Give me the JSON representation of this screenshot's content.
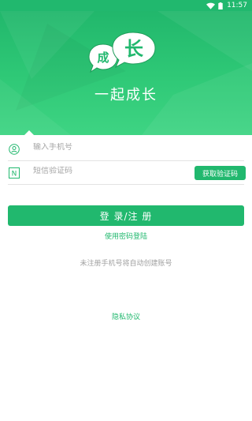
{
  "status_bar": {
    "time": "11:57"
  },
  "header": {
    "logo_char_small": "成",
    "logo_char_large": "长",
    "slogan": "一起成长"
  },
  "form": {
    "phone_placeholder": "输入手机号",
    "code_placeholder": "短信验证码",
    "get_code_label": "获取验证码",
    "code_icon_letter": "N"
  },
  "actions": {
    "login_label": "登 录/注 册",
    "password_login_link": "使用密码登陆",
    "auto_register_hint": "未注册手机号将自动创建账号",
    "privacy_link": "隐私协议"
  },
  "colors": {
    "primary": "#21b86e",
    "header_light": "#3ed483"
  },
  "icons": {
    "status_wifi": "wifi-icon",
    "status_battery": "battery-icon",
    "phone_field": "user-icon",
    "code_field": "sms-code-icon"
  }
}
